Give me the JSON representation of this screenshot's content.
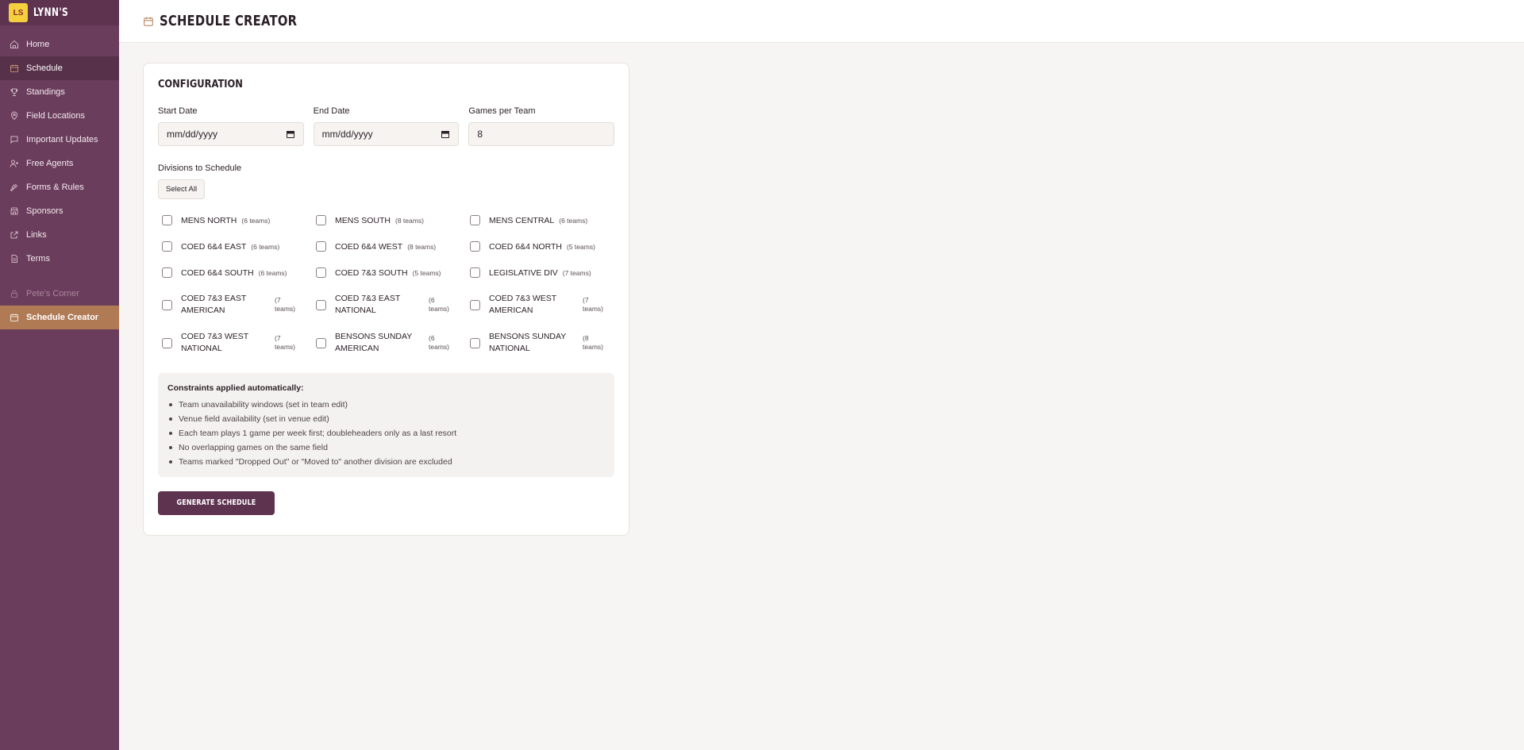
{
  "brand": {
    "name": "LYNN'S",
    "logo_text": "LS"
  },
  "sidebar": {
    "items": [
      {
        "label": "Home",
        "icon": "home-icon"
      },
      {
        "label": "Schedule",
        "icon": "calendar-icon"
      },
      {
        "label": "Standings",
        "icon": "trophy-icon"
      },
      {
        "label": "Field Locations",
        "icon": "map-pin-icon"
      },
      {
        "label": "Important Updates",
        "icon": "message-icon"
      },
      {
        "label": "Free Agents",
        "icon": "user-plus-icon"
      },
      {
        "label": "Forms & Rules",
        "icon": "gavel-icon"
      },
      {
        "label": "Sponsors",
        "icon": "store-icon"
      },
      {
        "label": "Links",
        "icon": "external-link-icon"
      },
      {
        "label": "Terms",
        "icon": "document-icon"
      }
    ],
    "extra": [
      {
        "label": "Pete's Corner",
        "icon": "lock-icon"
      },
      {
        "label": "Schedule Creator",
        "icon": "calendar-icon"
      }
    ]
  },
  "header": {
    "title": "SCHEDULE CREATOR"
  },
  "config": {
    "title": "CONFIGURATION",
    "start_date": {
      "label": "Start Date",
      "placeholder": "mm/dd/yyyy"
    },
    "end_date": {
      "label": "End Date",
      "placeholder": "mm/dd/yyyy"
    },
    "games_per_team": {
      "label": "Games per Team",
      "value": "8"
    },
    "divisions_label": "Divisions to Schedule",
    "select_all": "Select All",
    "divisions": [
      {
        "name": "MENS NORTH",
        "count": "(6 teams)"
      },
      {
        "name": "MENS SOUTH",
        "count": "(8 teams)"
      },
      {
        "name": "MENS CENTRAL",
        "count": "(6 teams)"
      },
      {
        "name": "COED 6&4 EAST",
        "count": "(6 teams)"
      },
      {
        "name": "COED 6&4 WEST",
        "count": "(8 teams)"
      },
      {
        "name": "COED 6&4 NORTH",
        "count": "(5 teams)"
      },
      {
        "name": "COED 6&4 SOUTH",
        "count": "(6 teams)"
      },
      {
        "name": "COED 7&3 SOUTH",
        "count": "(5 teams)"
      },
      {
        "name": "LEGISLATIVE DIV",
        "count": "(7 teams)"
      },
      {
        "name": "COED 7&3 EAST AMERICAN",
        "count": "(7 teams)"
      },
      {
        "name": "COED 7&3 EAST NATIONAL",
        "count": "(6 teams)"
      },
      {
        "name": "COED 7&3 WEST AMERICAN",
        "count": "(7 teams)"
      },
      {
        "name": "COED 7&3 WEST NATIONAL",
        "count": "(7 teams)"
      },
      {
        "name": "BENSONS SUNDAY AMERICAN",
        "count": "(6 teams)"
      },
      {
        "name": "BENSONS SUNDAY NATIONAL",
        "count": "(8 teams)"
      }
    ],
    "constraints": {
      "title": "Constraints applied automatically:",
      "items": [
        "Team unavailability windows (set in team edit)",
        "Venue field availability (set in venue edit)",
        "Each team plays 1 game per week first; doubleheaders only as a last resort",
        "No overlapping games on the same field",
        "Teams marked \"Dropped Out\" or \"Moved to\" another division are excluded"
      ]
    },
    "generate_button": "GENERATE SCHEDULE"
  }
}
